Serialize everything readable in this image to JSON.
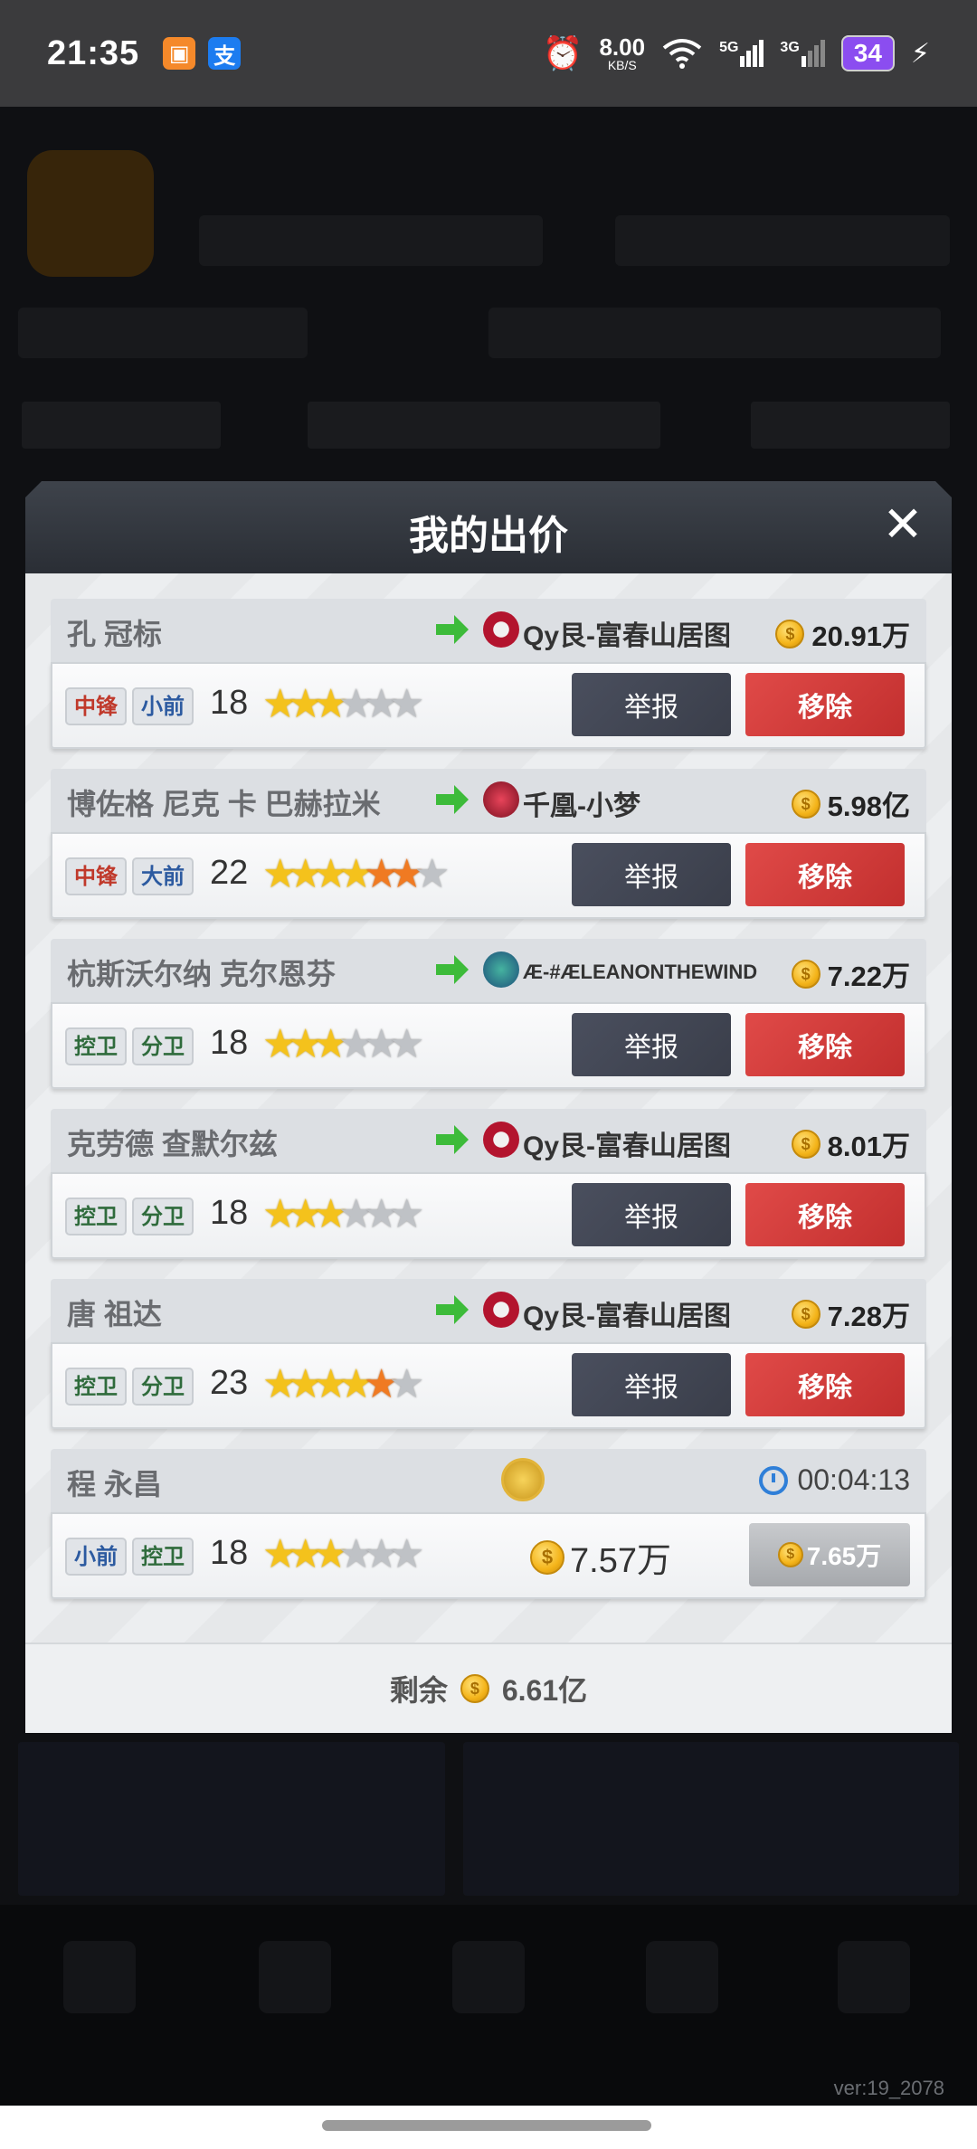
{
  "status_bar": {
    "time": "21:35",
    "speed_value": "8.00",
    "speed_unit": "KB/S",
    "net1": "5G",
    "net2": "3G",
    "battery": "34"
  },
  "modal": {
    "title": "我的出价",
    "close_icon": "close-icon",
    "bids": [
      {
        "player": "孔 冠标",
        "positions": [
          {
            "label": "中锋",
            "color": "red"
          },
          {
            "label": "小前",
            "color": "blue"
          }
        ],
        "age": "18",
        "stars": {
          "gold": 3,
          "orange": 0,
          "gray": 3
        },
        "team": "Qy艮-富春山居图",
        "price": "20.91万",
        "report_label": "举报",
        "remove_label": "移除"
      },
      {
        "player": "博佐格 尼克 卡 巴赫拉米",
        "positions": [
          {
            "label": "中锋",
            "color": "red"
          },
          {
            "label": "大前",
            "color": "blue"
          }
        ],
        "age": "22",
        "stars": {
          "gold": 4,
          "orange": 2,
          "gray": 1
        },
        "team": "千凰-小梦",
        "price": "5.98亿",
        "report_label": "举报",
        "remove_label": "移除"
      },
      {
        "player": "杭斯沃尔纳 克尔恩芬",
        "positions": [
          {
            "label": "控卫",
            "color": "green"
          },
          {
            "label": "分卫",
            "color": "green"
          }
        ],
        "age": "18",
        "stars": {
          "gold": 3,
          "orange": 0,
          "gray": 3
        },
        "team": "Æ-#ÆLEANONTHEWIND",
        "price": "7.22万",
        "report_label": "举报",
        "remove_label": "移除"
      },
      {
        "player": "克劳德 查默尔兹",
        "positions": [
          {
            "label": "控卫",
            "color": "green"
          },
          {
            "label": "分卫",
            "color": "green"
          }
        ],
        "age": "18",
        "stars": {
          "gold": 3,
          "orange": 0,
          "gray": 3
        },
        "team": "Qy艮-富春山居图",
        "price": "8.01万",
        "report_label": "举报",
        "remove_label": "移除"
      },
      {
        "player": "唐 祖达",
        "positions": [
          {
            "label": "控卫",
            "color": "green"
          },
          {
            "label": "分卫",
            "color": "green"
          }
        ],
        "age": "23",
        "stars": {
          "gold": 4,
          "orange": 1,
          "gray": 1
        },
        "team": "Qy艮-富春山居图",
        "price": "7.28万",
        "report_label": "举报",
        "remove_label": "移除"
      }
    ],
    "auction": {
      "player": "程 永昌",
      "positions": [
        {
          "label": "小前",
          "color": "blue"
        },
        {
          "label": "控卫",
          "color": "green"
        }
      ],
      "age": "18",
      "stars": {
        "gold": 3,
        "orange": 0,
        "gray": 3
      },
      "timer": "00:04:13",
      "current_price": "7.57万",
      "bid_price": "7.65万"
    },
    "footer": {
      "label": "剩余",
      "amount": "6.61亿"
    }
  },
  "version": "ver:19_2078"
}
